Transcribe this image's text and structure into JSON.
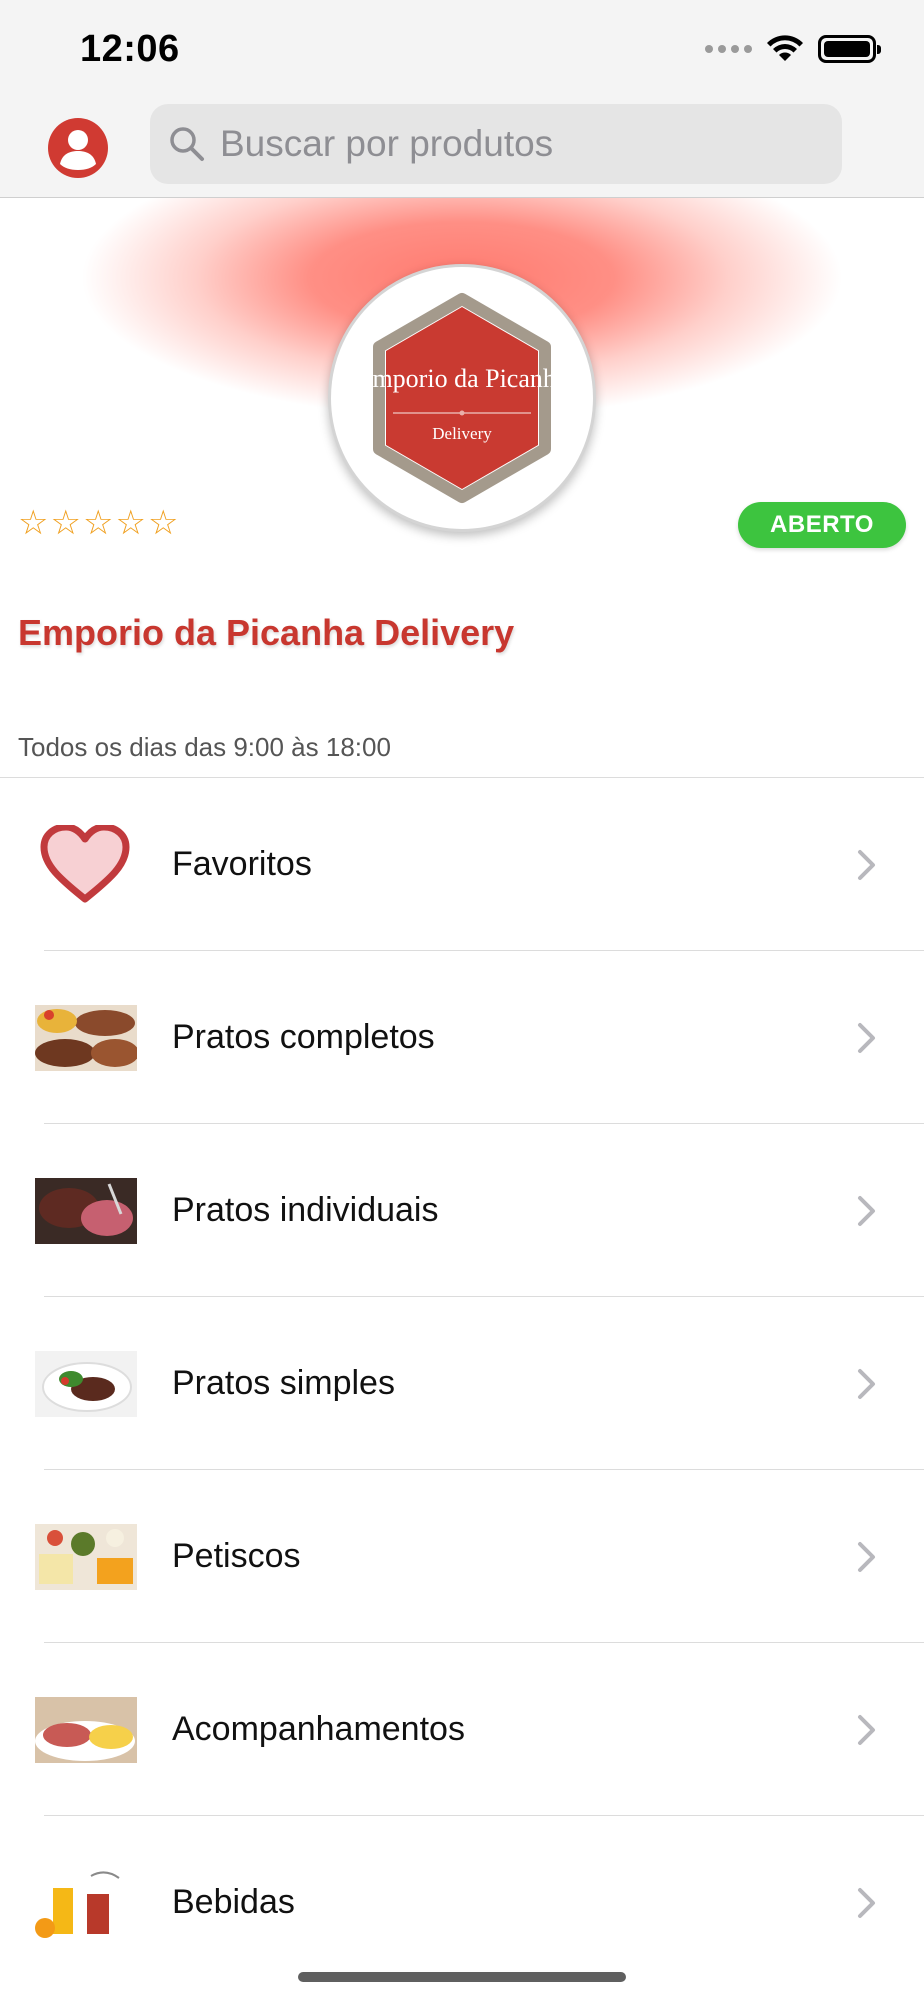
{
  "status_bar": {
    "time": "12:06",
    "icons": [
      "signal-icon",
      "wifi-icon",
      "battery-icon"
    ]
  },
  "nav": {
    "profile_icon": "user-icon",
    "search_placeholder": "Buscar por produtos",
    "search_icon": "search-icon"
  },
  "store": {
    "logo_line1": "Emporio da Picanha",
    "logo_line2": "Delivery",
    "rating_stars": 0,
    "rating_max": 5,
    "status_badge": "ABERTO",
    "status_color": "#3dc43f",
    "name": "Emporio da Picanha Delivery",
    "name_color": "#c8372f",
    "hours": "Todos os dias das 9:00 às 18:00"
  },
  "categories": [
    {
      "label": "Favoritos",
      "icon": "heart-icon"
    },
    {
      "label": "Pratos completos",
      "icon": "pratos-completos-image"
    },
    {
      "label": "Pratos individuais",
      "icon": "pratos-individuais-image"
    },
    {
      "label": "Pratos simples",
      "icon": "pratos-simples-image"
    },
    {
      "label": "Petiscos",
      "icon": "petiscos-image"
    },
    {
      "label": "Acompanhamentos",
      "icon": "acompanhamentos-image"
    },
    {
      "label": "Bebidas",
      "icon": "bebidas-image"
    }
  ]
}
